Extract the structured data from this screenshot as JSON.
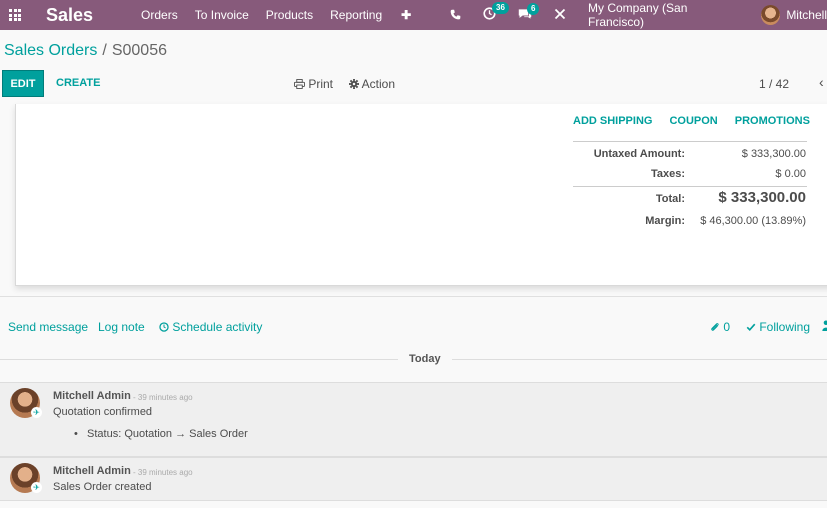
{
  "navbar": {
    "app_name": "Sales",
    "menu": [
      "Orders",
      "To Invoice",
      "Products",
      "Reporting"
    ],
    "plus": "✚",
    "phone_icon": "phone-icon",
    "activities_badge": "36",
    "messages_badge": "6",
    "company": "My Company (San Francisco)",
    "user": "Mitchell"
  },
  "breadcrumb": {
    "parent": "Sales Orders",
    "separator": "/",
    "current": "S00056"
  },
  "toolbar": {
    "edit_label": "EDIT",
    "create_label": "CREATE",
    "print_label": "Print",
    "action_label": "Action",
    "pager": "1 / 42"
  },
  "order_links": [
    "ADD SHIPPING",
    "COUPON",
    "PROMOTIONS"
  ],
  "totals": {
    "untaxed_label": "Untaxed Amount:",
    "untaxed_value": "$ 333,300.00",
    "taxes_label": "Taxes:",
    "taxes_value": "$ 0.00",
    "total_label": "Total:",
    "total_value": "$ 333,300.00",
    "margin_label": "Margin:",
    "margin_value": "$ 46,300.00 (13.89%)"
  },
  "chatter": {
    "send_message": "Send message",
    "log_note": "Log note",
    "schedule_activity": "Schedule activity",
    "attachments": "0",
    "following": "Following",
    "today": "Today",
    "messages": [
      {
        "author": "Mitchell Admin",
        "time": "- 39 minutes ago",
        "body": "Quotation confirmed",
        "tracking": "Status: Quotation → Sales Order"
      },
      {
        "author": "Mitchell Admin",
        "time": "- 39 minutes ago",
        "body": "Sales Order created"
      }
    ]
  },
  "colors": {
    "navbar": "#875a7b",
    "accent": "#00a09d"
  }
}
